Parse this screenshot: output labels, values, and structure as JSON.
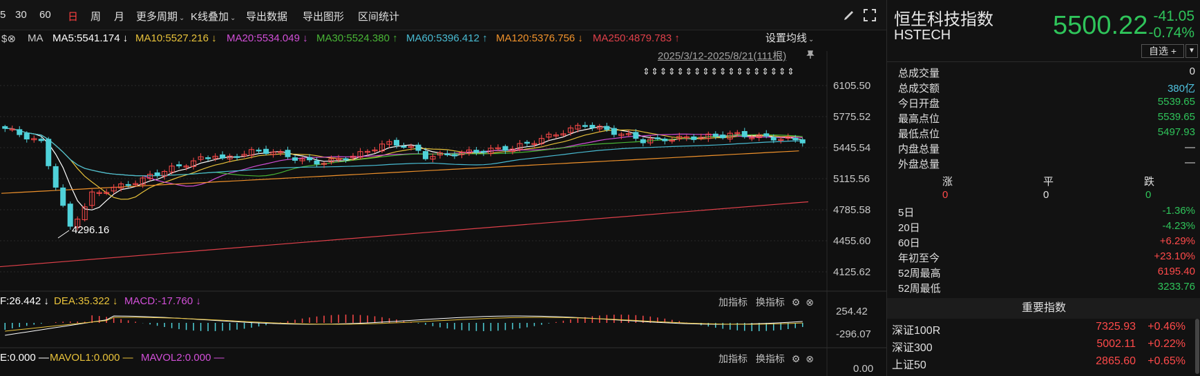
{
  "toolbar": {
    "items": [
      "5",
      "30",
      "60",
      "日",
      "周",
      "月",
      "更多周期",
      "K线叠加",
      "导出数据",
      "导出图形",
      "区间统计"
    ],
    "active": "日"
  },
  "ma_bar": {
    "prefix": "MA",
    "ma5": "MA5:5541.174 ↓",
    "ma10": "MA10:5527.216 ↓",
    "ma20": "MA20:5534.049 ↓",
    "ma30": "MA30:5524.380 ↑",
    "ma60": "MA60:5396.412 ↑",
    "ma120": "MA120:5376.756 ↓",
    "ma250": "MA250:4879.783 ↑",
    "settings_label": "设置均线",
    "range": "2025/3/12-2025/8/21(111根)"
  },
  "colors": {
    "ma5": "#ffffff",
    "ma10": "#e8c23a",
    "ma20": "#d24fd8",
    "ma30": "#49b636",
    "ma60": "#49bcd3",
    "ma120": "#f0922b",
    "ma250": "#e0404a",
    "up": "#ff4a4a",
    "down": "#4fd1d9"
  },
  "chart": {
    "y_ticks": [
      "6105.50",
      "5775.52",
      "5445.54",
      "5115.56",
      "4785.58",
      "4455.60",
      "4125.62"
    ],
    "low_marker": "4296.16"
  },
  "macd": {
    "dif": "F:26.442 ↓",
    "dea": "DEA:35.322 ↓",
    "macd": "MACD:-17.760 ↓",
    "ticks": [
      "254.42",
      "-296.07"
    ]
  },
  "vol": {
    "vol": "E:0.000 —",
    "mavol1": "MAVOL1:0.000 —",
    "mavol2": "MAVOL2:0.000 —",
    "ticks": [
      "0.00"
    ]
  },
  "subtools": {
    "add": "加指标",
    "switch": "换指标"
  },
  "quote": {
    "name": "恒生科技指数",
    "code": "HSTECH",
    "price": "5500.22",
    "change": "-41.05",
    "pct": "-0.74%",
    "watch_label": "自选 +",
    "stats": [
      {
        "k": "总成交量",
        "v": "0",
        "c": "#e0e0e0"
      },
      {
        "k": "总成交额",
        "v": "380亿",
        "c": "#4fc3e0"
      },
      {
        "k": "今日开盘",
        "v": "5539.65",
        "c": "#2fc45a"
      },
      {
        "k": "最高点位",
        "v": "5539.65",
        "c": "#2fc45a"
      },
      {
        "k": "最低点位",
        "v": "5497.93",
        "c": "#2fc45a"
      },
      {
        "k": "内盘总量",
        "v": "—",
        "c": "#e0e0e0"
      },
      {
        "k": "外盘总量",
        "v": "—",
        "c": "#e0e0e0"
      }
    ],
    "breadth_labels": [
      "涨",
      "平",
      "跌"
    ],
    "breadth_values": [
      "0",
      "0",
      "0"
    ],
    "perf": [
      {
        "k": "5日",
        "v": "-1.36%",
        "c": "#2fc45a"
      },
      {
        "k": "20日",
        "v": "-4.23%",
        "c": "#2fc45a"
      },
      {
        "k": "60日",
        "v": "+6.29%",
        "c": "#ff4a4a"
      },
      {
        "k": "年初至今",
        "v": "+23.10%",
        "c": "#ff4a4a"
      },
      {
        "k": "52周最高",
        "v": "6195.40",
        "c": "#ff4a4a"
      },
      {
        "k": "52周最低",
        "v": "3233.76",
        "c": "#2fc45a"
      }
    ],
    "key_index_title": "重要指数",
    "key_indices": [
      {
        "n": "深证100R",
        "p": "7325.93",
        "c": "+0.46%"
      },
      {
        "n": "深证300",
        "p": "5002.11",
        "c": "+0.22%"
      },
      {
        "n": "上证50",
        "p": "2865.60",
        "c": "+0.65%"
      }
    ]
  }
}
